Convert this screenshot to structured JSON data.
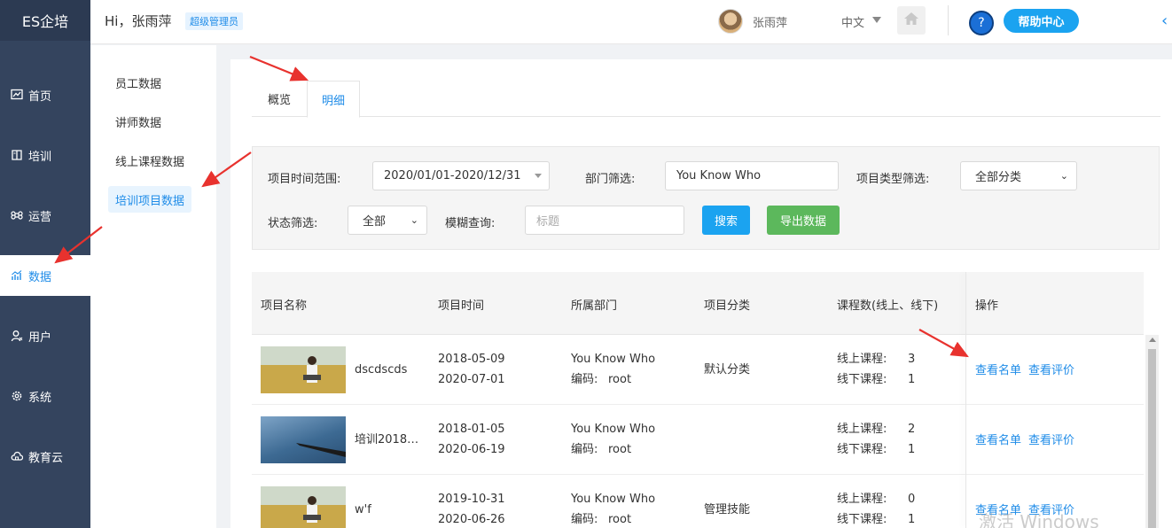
{
  "brand": "ES企培",
  "header": {
    "greeting": "Hi，张雨萍",
    "role": "超级管理员",
    "user_name": "张雨萍",
    "language": "中文",
    "help_icon_text": "?",
    "help_label": "帮助中心",
    "collapse_glyph": "‹"
  },
  "nav": {
    "items": [
      {
        "label": "首页",
        "icon": "chart-line-icon"
      },
      {
        "label": "培训",
        "icon": "book-icon"
      },
      {
        "label": "运营",
        "icon": "command-icon"
      },
      {
        "label": "数据",
        "icon": "bar-trend-icon"
      },
      {
        "label": "用户",
        "icon": "user-icon"
      },
      {
        "label": "系统",
        "icon": "gear-icon"
      },
      {
        "label": "教育云",
        "icon": "cloud-icon"
      }
    ],
    "active": "数据"
  },
  "submenu": {
    "items": [
      "员工数据",
      "讲师数据",
      "线上课程数据",
      "培训项目数据"
    ],
    "active": "培训项目数据"
  },
  "tabs": {
    "items": [
      "概览",
      "明细"
    ],
    "active": "明细"
  },
  "filters": {
    "time_label": "项目时间范围:",
    "time_value": "2020/01/01-2020/12/31",
    "dept_label": "部门筛选:",
    "dept_value": "You Know Who",
    "type_label": "项目类型筛选:",
    "type_value": "全部分类",
    "status_label": "状态筛选:",
    "status_value": "全部",
    "fuzzy_label": "模糊查询:",
    "fuzzy_placeholder": "标题",
    "search_label": "搜索",
    "export_label": "导出数据",
    "caret_glyph": "⌄"
  },
  "table": {
    "headers": [
      "项目名称",
      "项目时间",
      "所属部门",
      "项目分类",
      "课程数(线上、线下)",
      "操作"
    ],
    "rows": [
      {
        "name": "dscdscds",
        "start": "2018-05-09",
        "end": "2020-07-01",
        "dept": "You Know Who",
        "code_label": "编码:",
        "code": "root",
        "category": "默认分类",
        "online_label": "线上课程:",
        "online": "3",
        "offline_label": "线下课程:",
        "offline": "1",
        "op_list": "查看名单",
        "op_review": "查看评价"
      },
      {
        "name": "培训2018…",
        "start": "2018-01-05",
        "end": "2020-06-19",
        "dept": "You Know Who",
        "code_label": "编码:",
        "code": "root",
        "category": "",
        "online_label": "线上课程:",
        "online": "2",
        "offline_label": "线下课程:",
        "offline": "1",
        "op_list": "查看名单",
        "op_review": "查看评价"
      },
      {
        "name": "w'f",
        "start": "2019-10-31",
        "end": "2020-06-26",
        "dept": "You Know Who",
        "code_label": "编码:",
        "code": "root",
        "category": "管理技能",
        "online_label": "线上课程:",
        "online": "0",
        "offline_label": "线下课程:",
        "offline": "1",
        "op_list": "查看名单",
        "op_review": "查看评价"
      }
    ]
  },
  "watermark": "激活 Windows",
  "colors": {
    "accent": "#1f8ce8",
    "sidebar": "#34445e",
    "search_btn": "#1ba3f0",
    "export_btn": "#5cb85c",
    "annotation": "#e8322e"
  }
}
